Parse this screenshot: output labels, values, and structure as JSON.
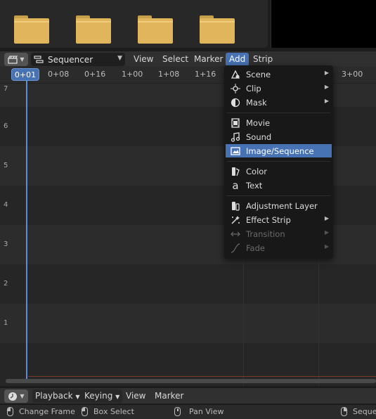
{
  "header": {
    "editor_type_icon": "clapperboard-icon",
    "view_type_icon": "sequencer-icon",
    "view_type": "Sequencer",
    "menus": [
      "View",
      "Select",
      "Marker",
      "Add",
      "Strip"
    ],
    "active_menu": "Add"
  },
  "ruler": {
    "current_frame": "0+01",
    "ticks": [
      "0+08",
      "0+16",
      "1+00",
      "1+08",
      "1+16",
      "3+00"
    ]
  },
  "channels": [
    "7",
    "6",
    "5",
    "4",
    "3",
    "2",
    "1"
  ],
  "add_menu": {
    "items": [
      {
        "label": "Scene",
        "icon": "scene-icon",
        "submenu": true,
        "disabled": false
      },
      {
        "label": "Clip",
        "icon": "clip-icon",
        "submenu": true,
        "disabled": false
      },
      {
        "label": "Mask",
        "icon": "mask-icon",
        "submenu": true,
        "disabled": false
      },
      {
        "label": "Movie",
        "icon": "movie-icon",
        "submenu": false,
        "disabled": false
      },
      {
        "label": "Sound",
        "icon": "sound-icon",
        "submenu": false,
        "disabled": false
      },
      {
        "label": "Image/Sequence",
        "icon": "image-icon",
        "submenu": false,
        "disabled": false,
        "selected": true
      },
      {
        "label": "Color",
        "icon": "color-icon",
        "submenu": false,
        "disabled": false
      },
      {
        "label": "Text",
        "icon": "text-icon",
        "submenu": false,
        "disabled": false
      },
      {
        "label": "Adjustment Layer",
        "icon": "adjustment-layer-icon",
        "submenu": false,
        "disabled": false
      },
      {
        "label": "Effect Strip",
        "icon": "effect-strip-icon",
        "submenu": true,
        "disabled": false
      },
      {
        "label": "Transition",
        "icon": "transition-icon",
        "submenu": true,
        "disabled": true
      },
      {
        "label": "Fade",
        "icon": "fade-icon",
        "submenu": true,
        "disabled": true
      }
    ]
  },
  "timeline": {
    "editor_icon": "clock-icon",
    "playback": "Playback",
    "keying": "Keying",
    "view": "View",
    "marker": "Marker"
  },
  "status": {
    "change_frame": "Change Frame",
    "box_select": "Box Select",
    "pan_view": "Pan View",
    "truncated": "Seque"
  },
  "colors": {
    "accent": "#4772b3",
    "folder": "#e0b55c",
    "playhead": "#5b8fd8"
  }
}
